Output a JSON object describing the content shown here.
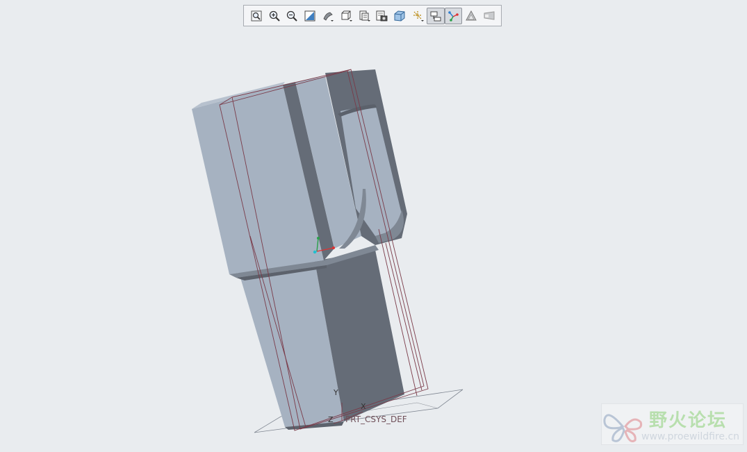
{
  "toolbar": {
    "buttons": [
      {
        "name": "refit-button",
        "icon": "refit-icon",
        "pressed": false
      },
      {
        "name": "zoom-in-button",
        "icon": "zoom-in-icon",
        "pressed": false
      },
      {
        "name": "zoom-out-button",
        "icon": "zoom-out-icon",
        "pressed": false
      },
      {
        "name": "repaint-button",
        "icon": "repaint-icon",
        "pressed": false
      },
      {
        "name": "spin-center-button",
        "icon": "spin-center-icon",
        "pressed": false
      },
      {
        "name": "saved-orientations-button",
        "icon": "saved-orientations-icon",
        "pressed": false
      },
      {
        "name": "saved-views-button",
        "icon": "saved-views-icon",
        "pressed": false
      },
      {
        "name": "view-manager-button",
        "icon": "view-manager-icon",
        "pressed": false
      },
      {
        "name": "display-style-button",
        "icon": "display-style-icon",
        "pressed": false
      },
      {
        "name": "datum-display-button",
        "icon": "datum-display-icon",
        "pressed": false
      },
      {
        "name": "annotation-display-button",
        "icon": "annotation-display-icon",
        "pressed": true
      },
      {
        "name": "spin-center-display-button",
        "icon": "spin-center-display-icon",
        "pressed": true
      },
      {
        "name": "appearance-button",
        "icon": "appearance-icon",
        "pressed": false
      },
      {
        "name": "perspective-button",
        "icon": "perspective-icon",
        "pressed": false
      }
    ]
  },
  "viewport": {
    "csys_label": "PRT_CSYS_DEF",
    "axis_x": "X",
    "axis_y": "Y",
    "axis_z": "Z",
    "model_colors": {
      "light_face": "#a6b2c1",
      "dark_face": "#656c77",
      "mid_face": "#7f8894",
      "edge_line": "#7a3a48"
    }
  },
  "watermark": {
    "title": "野火论坛",
    "url": "www.proewildfire.cn"
  }
}
